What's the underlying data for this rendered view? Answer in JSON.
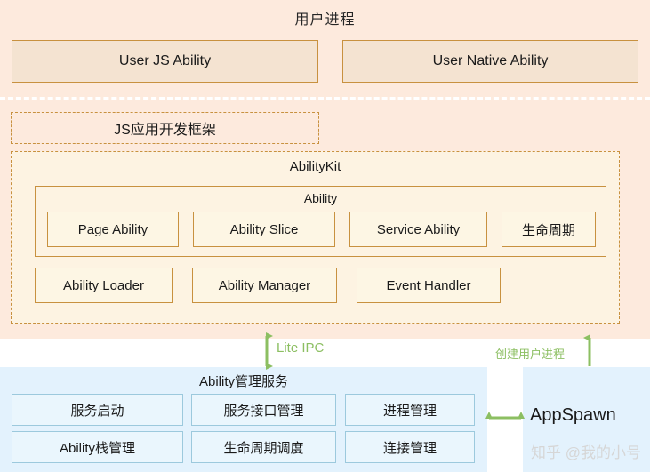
{
  "diagram": {
    "user_process": {
      "title": "用户进程",
      "top_abilities": [
        {
          "label": "User JS Ability"
        },
        {
          "label": "User Native Ability"
        }
      ],
      "js_framework": {
        "label": "JS应用开发框架"
      },
      "ability_kit": {
        "label": "AbilityKit",
        "ability_group": {
          "label": "Ability",
          "items": [
            {
              "label": "Page Ability"
            },
            {
              "label": "Ability Slice"
            },
            {
              "label": "Service Ability"
            },
            {
              "label": "生命周期"
            }
          ]
        },
        "support_items": [
          {
            "label": "Ability Loader"
          },
          {
            "label": "Ability Manager"
          },
          {
            "label": "Event Handler"
          }
        ]
      }
    },
    "connectors": [
      {
        "label": "Lite IPC",
        "direction": "bidirectional-vertical"
      },
      {
        "label": "创建用户进程",
        "direction": "up"
      },
      {
        "label": "",
        "direction": "bidirectional-horizontal"
      }
    ],
    "ability_manager_service": {
      "title": "Ability管理服务",
      "items": [
        {
          "label": "服务启动"
        },
        {
          "label": "服务接口管理"
        },
        {
          "label": "进程管理"
        },
        {
          "label": "Ability栈管理"
        },
        {
          "label": "生命周期调度"
        },
        {
          "label": "连接管理"
        }
      ]
    },
    "app_spawn": {
      "label": "AppSpawn"
    },
    "watermark": {
      "label": "知乎 @我的小号"
    },
    "colors": {
      "user_process_bg": "#fdeadd",
      "ability_kit_bg": "#fdf3e2",
      "chip_bg": "#fdf6e4",
      "chip_border": "#c8913f",
      "service_bg": "#e3f2fd",
      "service_chip_bg": "#eaf6fd",
      "service_chip_border": "#9cc9dd",
      "arrow_green": "#8cbf62"
    }
  }
}
